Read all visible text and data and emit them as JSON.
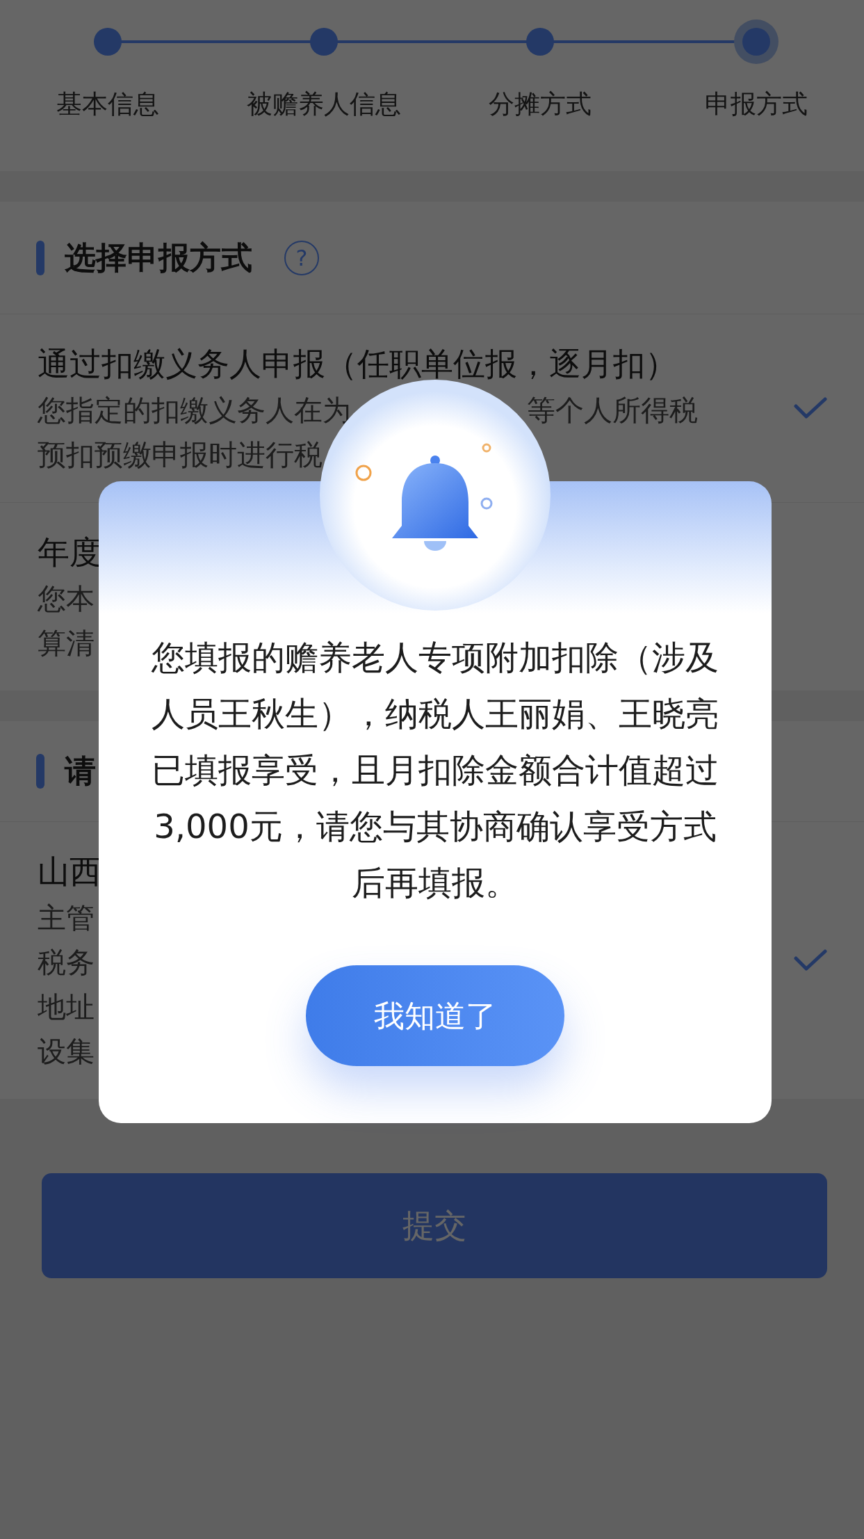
{
  "steps": [
    {
      "label": "基本信息",
      "selected": false
    },
    {
      "label": "被赡养人信息",
      "selected": false
    },
    {
      "label": "分摊方式",
      "selected": false
    },
    {
      "label": "申报方式",
      "selected": true
    }
  ],
  "sections": [
    {
      "title": "选择申报方式",
      "help": "?",
      "options": [
        {
          "title": "通过扣缴义务人申报（任职单位报，逐月扣）",
          "description_lines": [
            [
              "您指定的扣缴义务人在为",
              "等个人所得税"
            ],
            [
              "预扣预缴申报时进行税"
            ]
          ],
          "selected": true
        },
        {
          "title": "年度",
          "description_lines": [
            [
              "您本"
            ],
            [
              "算清"
            ]
          ],
          "selected": false
        }
      ]
    },
    {
      "title": "请",
      "options": [
        {
          "title": "山西",
          "description_lines": [
            [
              "主管"
            ],
            [
              "税务"
            ],
            [
              "地址"
            ],
            [
              "设集"
            ]
          ],
          "selected": true
        }
      ]
    }
  ],
  "submit": {
    "label": "提交"
  },
  "dialog": {
    "message": "您填报的赡养老人专项附加扣除（涉及人员王秋生），纳税人王丽娟、王晓亮已填报享受，且月扣除金额合计值超过3,000元，请您与其协商确认享受方式后再填报。",
    "button": "我知道了"
  }
}
